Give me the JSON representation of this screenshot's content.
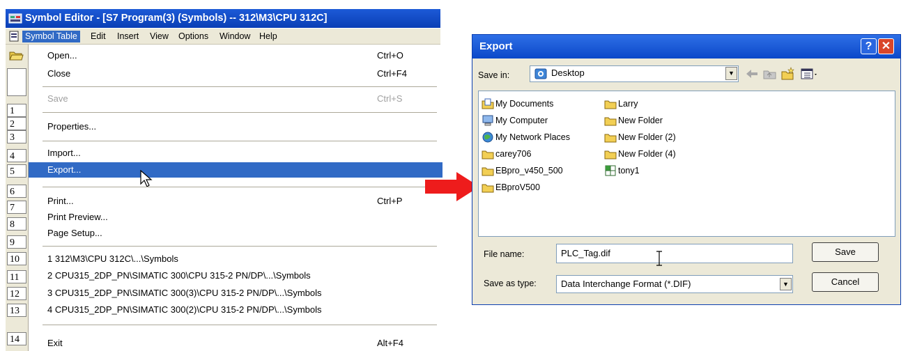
{
  "editor": {
    "title": "Symbol Editor - [S7 Program(3) (Symbols) -- 312\\M3\\CPU 312C]",
    "menubar": [
      "Symbol Table",
      "Edit",
      "Insert",
      "View",
      "Options",
      "Window",
      "Help"
    ],
    "row_numbers": [
      "1",
      "2",
      "3",
      "4",
      "5",
      "6",
      "7",
      "8",
      "9",
      "10",
      "11",
      "12",
      "13",
      "14"
    ],
    "menu_items": [
      {
        "label": "Open...",
        "shortcut": "Ctrl+O"
      },
      {
        "label": "Close",
        "shortcut": "Ctrl+F4"
      },
      {
        "label": "Save",
        "shortcut": "Ctrl+S",
        "disabled": true
      },
      {
        "label": "Properties...",
        "shortcut": ""
      },
      {
        "label": "Import...",
        "shortcut": ""
      },
      {
        "label": "Export...",
        "shortcut": "",
        "selected": true
      },
      {
        "label": "Print...",
        "shortcut": "Ctrl+P"
      },
      {
        "label": "Print Preview...",
        "shortcut": ""
      },
      {
        "label": "Page Setup...",
        "shortcut": ""
      },
      {
        "label": "1 312\\M3\\CPU 312C\\...\\Symbols",
        "shortcut": ""
      },
      {
        "label": "2 CPU315_2DP_PN\\SIMATIC 300\\CPU 315-2 PN/DP\\...\\Symbols",
        "shortcut": ""
      },
      {
        "label": "3 CPU315_2DP_PN\\SIMATIC 300(3)\\CPU 315-2 PN/DP\\...\\Symbols",
        "shortcut": ""
      },
      {
        "label": "4 CPU315_2DP_PN\\SIMATIC 300(2)\\CPU 315-2 PN/DP\\...\\Symbols",
        "shortcut": ""
      },
      {
        "label": "Exit",
        "shortcut": "Alt+F4"
      }
    ]
  },
  "dialog": {
    "title": "Export",
    "help_glyph": "?",
    "close_glyph": "✕",
    "save_in_label": "Save in:",
    "save_in_value": "Desktop",
    "files": [
      {
        "name": "My Documents",
        "icon": "my-documents-icon"
      },
      {
        "name": "My Computer",
        "icon": "my-computer-icon"
      },
      {
        "name": "My Network Places",
        "icon": "network-places-icon"
      },
      {
        "name": "carey706",
        "icon": "folder-icon"
      },
      {
        "name": "EBpro_v450_500",
        "icon": "folder-icon"
      },
      {
        "name": "EBproV500",
        "icon": "folder-icon"
      },
      {
        "name": "Larry",
        "icon": "folder-icon"
      },
      {
        "name": "New Folder",
        "icon": "folder-icon"
      },
      {
        "name": "New Folder (2)",
        "icon": "folder-icon"
      },
      {
        "name": "New Folder (4)",
        "icon": "folder-icon"
      },
      {
        "name": "tony1",
        "icon": "spreadsheet-file-icon"
      }
    ],
    "file_name_label": "File name:",
    "file_name_value": "PLC_Tag.dif",
    "save_as_type_label": "Save as type:",
    "save_as_type_value": "Data Interchange Format (*.DIF)",
    "save_button": "Save",
    "cancel_button": "Cancel"
  },
  "colors": {
    "menu_highlight": "#316ac5",
    "title_blue": "#0a3fb5",
    "arrow": "#ee1c1c"
  }
}
